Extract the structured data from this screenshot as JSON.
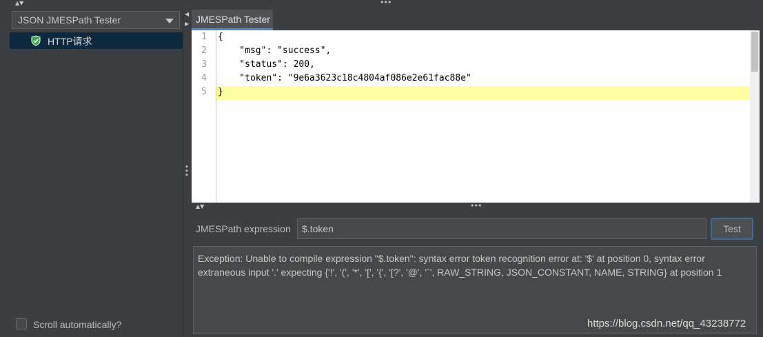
{
  "left_panel": {
    "dropdown_value": "JSON JMESPath Tester",
    "tree_item_label": "HTTP请求",
    "scroll_checkbox_label": "Scroll automatically?",
    "scroll_checked": false
  },
  "tab": {
    "label": "JMESPath Tester"
  },
  "editor": {
    "lines": [
      {
        "no": "1",
        "text": "{"
      },
      {
        "no": "2",
        "text": "    \"msg\": \"success\","
      },
      {
        "no": "3",
        "text": "    \"status\": 200,"
      },
      {
        "no": "4",
        "text": "    \"token\": \"9e6a3623c18c4804af086e2e61fac88e\""
      },
      {
        "no": "5",
        "text": "}"
      }
    ],
    "highlighted_line": "5"
  },
  "expression": {
    "label": "JMESPath expression",
    "value": "$.token",
    "test_button": "Test"
  },
  "result": {
    "text": "Exception: Unable to compile expression \"$.token\": syntax error token recognition error at: '$' at position 0, syntax error extraneous input '.' expecting {'!', '(', '*', '[', '{', '[?', '@', '`', RAW_STRING, JSON_CONSTANT, NAME, STRING} at position 1"
  },
  "watermark": "https://blog.csdn.net/qq_43238772",
  "colors": {
    "background": "#3c3f41",
    "selection": "#0d293e",
    "highlight_line": "#ffffa0",
    "tab_accent": "#4a88c7"
  }
}
